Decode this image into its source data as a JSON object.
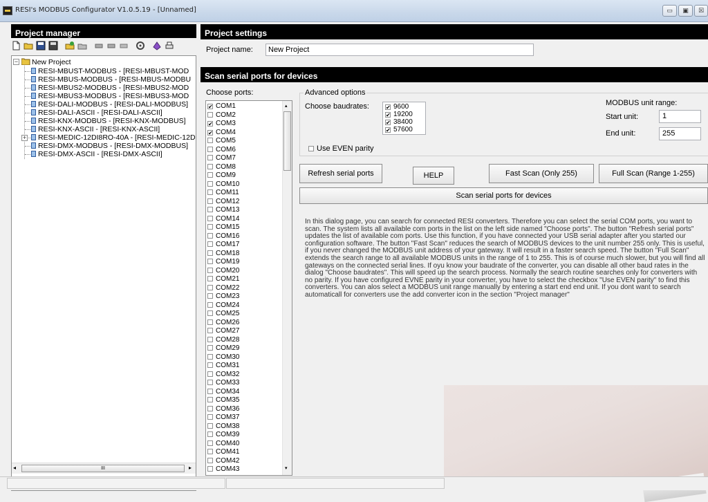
{
  "window": {
    "title": "RESI's MODBUS Configurator V1.0.5.19 - [Unnamed]",
    "minimize_label": "▭",
    "maximize_label": "▣",
    "close_label": "☒"
  },
  "project_manager": {
    "title": "Project manager",
    "toolbar_icons": [
      "new-file-icon",
      "open-folder-icon",
      "save-icon",
      "save-as-icon",
      "open-project-icon",
      "delete-icon",
      "plug-icon",
      "unplug-icon",
      "cut-icon",
      "settings-icon",
      "help-book-icon",
      "print-icon"
    ],
    "tree": {
      "root": "New Project",
      "items": [
        "RESI-MBUST-MODBUS - [RESI-MBUST-MOD",
        "RESI-MBUS-MODBUS - [RESI-MBUS-MODBU",
        "RESI-MBUS2-MODBUS - [RESI-MBUS2-MOD",
        "RESI-MBUS3-MODBUS - [RESI-MBUS3-MOD",
        "RESI-DALI-MODBUS - [RESI-DALI-MODBUS]",
        "RESI-DALI-ASCII - [RESI-DALI-ASCII]",
        "RESI-KNX-MODBUS - [RESI-KNX-MODBUS]",
        "RESI-KNX-ASCII - [RESI-KNX-ASCII]",
        "RESI-MEDIC-12DI8RO-40A - [RESI-MEDIC-12D",
        "RESI-DMX-MODBUS - [RESI-DMX-MODBUS]",
        "RESI-DMX-ASCII - [RESI-DMX-ASCII]"
      ]
    },
    "scroll_thumb_label": "III"
  },
  "project_settings": {
    "title": "Project settings",
    "name_label": "Project name:",
    "name_value": "New Project"
  },
  "scan": {
    "title": "Scan serial ports for devices",
    "choose_ports_label": "Choose ports:",
    "ports": [
      {
        "label": "COM1",
        "checked": true
      },
      {
        "label": "COM2",
        "checked": false
      },
      {
        "label": "COM3",
        "checked": true
      },
      {
        "label": "COM4",
        "checked": true
      },
      {
        "label": "COM5",
        "checked": false
      },
      {
        "label": "COM6",
        "checked": false
      },
      {
        "label": "COM7",
        "checked": false
      },
      {
        "label": "COM8",
        "checked": false
      },
      {
        "label": "COM9",
        "checked": false
      },
      {
        "label": "COM10",
        "checked": false
      },
      {
        "label": "COM11",
        "checked": false
      },
      {
        "label": "COM12",
        "checked": false
      },
      {
        "label": "COM13",
        "checked": false
      },
      {
        "label": "COM14",
        "checked": false
      },
      {
        "label": "COM15",
        "checked": false
      },
      {
        "label": "COM16",
        "checked": false
      },
      {
        "label": "COM17",
        "checked": false
      },
      {
        "label": "COM18",
        "checked": false
      },
      {
        "label": "COM19",
        "checked": false
      },
      {
        "label": "COM20",
        "checked": false
      },
      {
        "label": "COM21",
        "checked": false
      },
      {
        "label": "COM22",
        "checked": false
      },
      {
        "label": "COM23",
        "checked": false
      },
      {
        "label": "COM24",
        "checked": false
      },
      {
        "label": "COM25",
        "checked": false
      },
      {
        "label": "COM26",
        "checked": false
      },
      {
        "label": "COM27",
        "checked": false
      },
      {
        "label": "COM28",
        "checked": false
      },
      {
        "label": "COM29",
        "checked": false
      },
      {
        "label": "COM30",
        "checked": false
      },
      {
        "label": "COM31",
        "checked": false
      },
      {
        "label": "COM32",
        "checked": false
      },
      {
        "label": "COM33",
        "checked": false
      },
      {
        "label": "COM34",
        "checked": false
      },
      {
        "label": "COM35",
        "checked": false
      },
      {
        "label": "COM36",
        "checked": false
      },
      {
        "label": "COM37",
        "checked": false
      },
      {
        "label": "COM38",
        "checked": false
      },
      {
        "label": "COM39",
        "checked": false
      },
      {
        "label": "COM40",
        "checked": false
      },
      {
        "label": "COM41",
        "checked": false
      },
      {
        "label": "COM42",
        "checked": false
      },
      {
        "label": "COM43",
        "checked": false
      }
    ],
    "advanced_options_label": "Advanced options",
    "baudrates_label": "Choose baudrates:",
    "baudrates": [
      {
        "label": "9600",
        "checked": true
      },
      {
        "label": "19200",
        "checked": true
      },
      {
        "label": "38400",
        "checked": true
      },
      {
        "label": "57600",
        "checked": true
      }
    ],
    "even_parity_label": "Use EVEN parity",
    "even_parity_checked": false,
    "unit_range_label": "MODBUS unit range:",
    "start_unit_label": "Start unit:",
    "start_unit_value": "1",
    "end_unit_label": "End unit:",
    "end_unit_value": "255",
    "buttons": {
      "refresh": "Refresh serial ports",
      "help": "HELP",
      "fast_scan": "Fast Scan (Only 255)",
      "full_scan": "Full Scan (Range 1-255)",
      "scan": "Scan serial ports for devices"
    },
    "description": "In this dialog page, you can search for connected RESI converters. Therefore you can select the serial COM ports, you want to scan. The system lists all available com ports in the list on the left side named \"Choose ports\". The button \"Refresh serial ports\" updates the list of available com ports. Use this function, if you have connected your USB serial adapter after you started our configuration software. The button \"Fast Scan\" reduces the search of MODBUS devices to the unit number 255 only. This is useful, if you never changed the MODBUS unit address of your gateway. It will result in a faster search speed. The button \"Full Scan\" extends the search range to all available MODBUS units in the range of 1 to 255. This is of course much slower, but you will find all gateways on the connected serial lines. If oyu know your baudrate of the converter, you can disable all other baud rates in the dialog \"Choose baudrates\". This will speed up the search process. Normally the search routine searches only for converters with no parity. If you have configured EVNE parity in your converter, you have to select the checkbox \"Use EVEN parity\" to find this converters. You can alos select a MODBUS unit range manually by entering a start end end unit. If you dont want to search automaticall for converters use the add converter icon in the section \"Project manager\""
  }
}
